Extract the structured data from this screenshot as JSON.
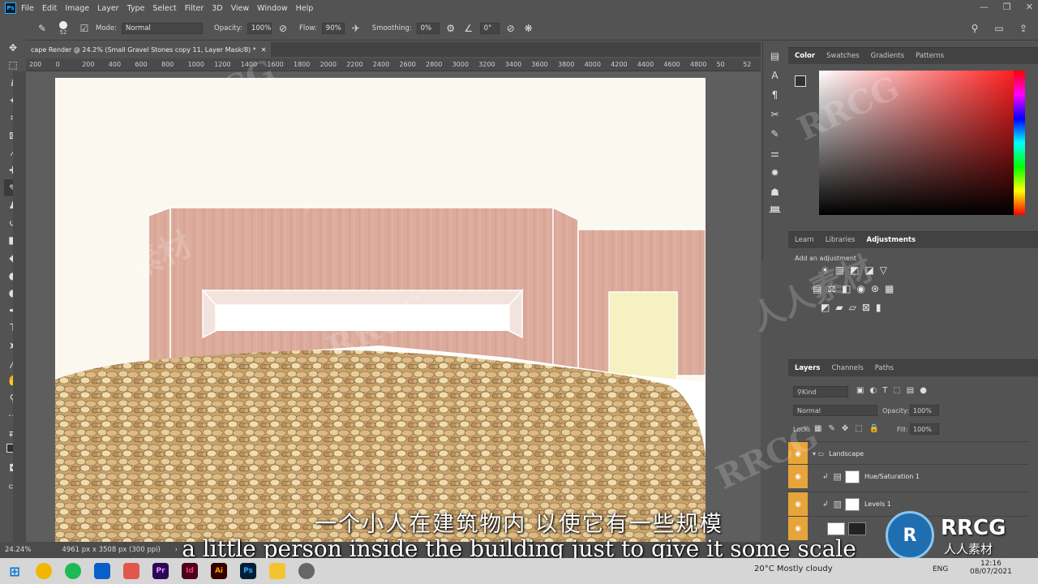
{
  "app": {
    "logo": "Ps"
  },
  "menu": [
    "File",
    "Edit",
    "Image",
    "Layer",
    "Type",
    "Select",
    "Filter",
    "3D",
    "View",
    "Window",
    "Help"
  ],
  "options": {
    "brush_size": "52",
    "mode_label": "Mode:",
    "mode_value": "Normal",
    "opacity_label": "Opacity:",
    "opacity_value": "100%",
    "flow_label": "Flow:",
    "flow_value": "90%",
    "smoothing_label": "Smoothing:",
    "smoothing_value": "0%",
    "angle_value": "0°"
  },
  "document": {
    "tab_title": "cape Render @ 24.2% (Small Gravel Stones copy 11, Layer Mask/8) *",
    "zoom": "24.24%",
    "dimensions": "4961 px x 3508 px (300 ppi)"
  },
  "ruler_labels": [
    "200",
    "0",
    "200",
    "400",
    "600",
    "800",
    "1000",
    "1200",
    "1400",
    "1600",
    "1800",
    "2000",
    "2200",
    "2400",
    "2600",
    "2800",
    "3000",
    "3200",
    "3400",
    "3600",
    "3800",
    "4000",
    "4200",
    "4400",
    "4600",
    "4800",
    "50",
    "52"
  ],
  "color_panel": {
    "tabs": [
      "Color",
      "Swatches",
      "Gradients",
      "Patterns"
    ]
  },
  "adjust_panel": {
    "tabs": [
      "Learn",
      "Libraries",
      "Adjustments"
    ],
    "hint": "Add an adjustment"
  },
  "layers_panel": {
    "tabs": [
      "Layers",
      "Channels",
      "Paths"
    ],
    "kind_label": "Kind",
    "blend_mode": "Normal",
    "opacity_label": "Opacity:",
    "opacity_value": "100%",
    "lock_label": "Lock:",
    "fill_label": "Fill:",
    "fill_value": "100%",
    "layers": [
      {
        "name": "Landscape"
      },
      {
        "name": "Hue/Saturation 1"
      },
      {
        "name": "Levels 1"
      }
    ]
  },
  "subtitles": {
    "cn": "一个小人在建筑物内 以使它有一些规模",
    "en": "a little person inside the building just to give it some scale"
  },
  "watermarks": {
    "rrcg": "RRCG",
    "cn": "人人素材"
  },
  "taskbar": {
    "weather": "20°C  Mostly cloudy",
    "lang": "ENG",
    "time": "12:16",
    "date": "08/07/2021",
    "apps": [
      "Pr",
      "Id",
      "Ai",
      "Ps"
    ]
  },
  "colors": {
    "accent_layer": "#e7a43a",
    "brick": "#dba99a",
    "ui_bg": "#535353"
  }
}
